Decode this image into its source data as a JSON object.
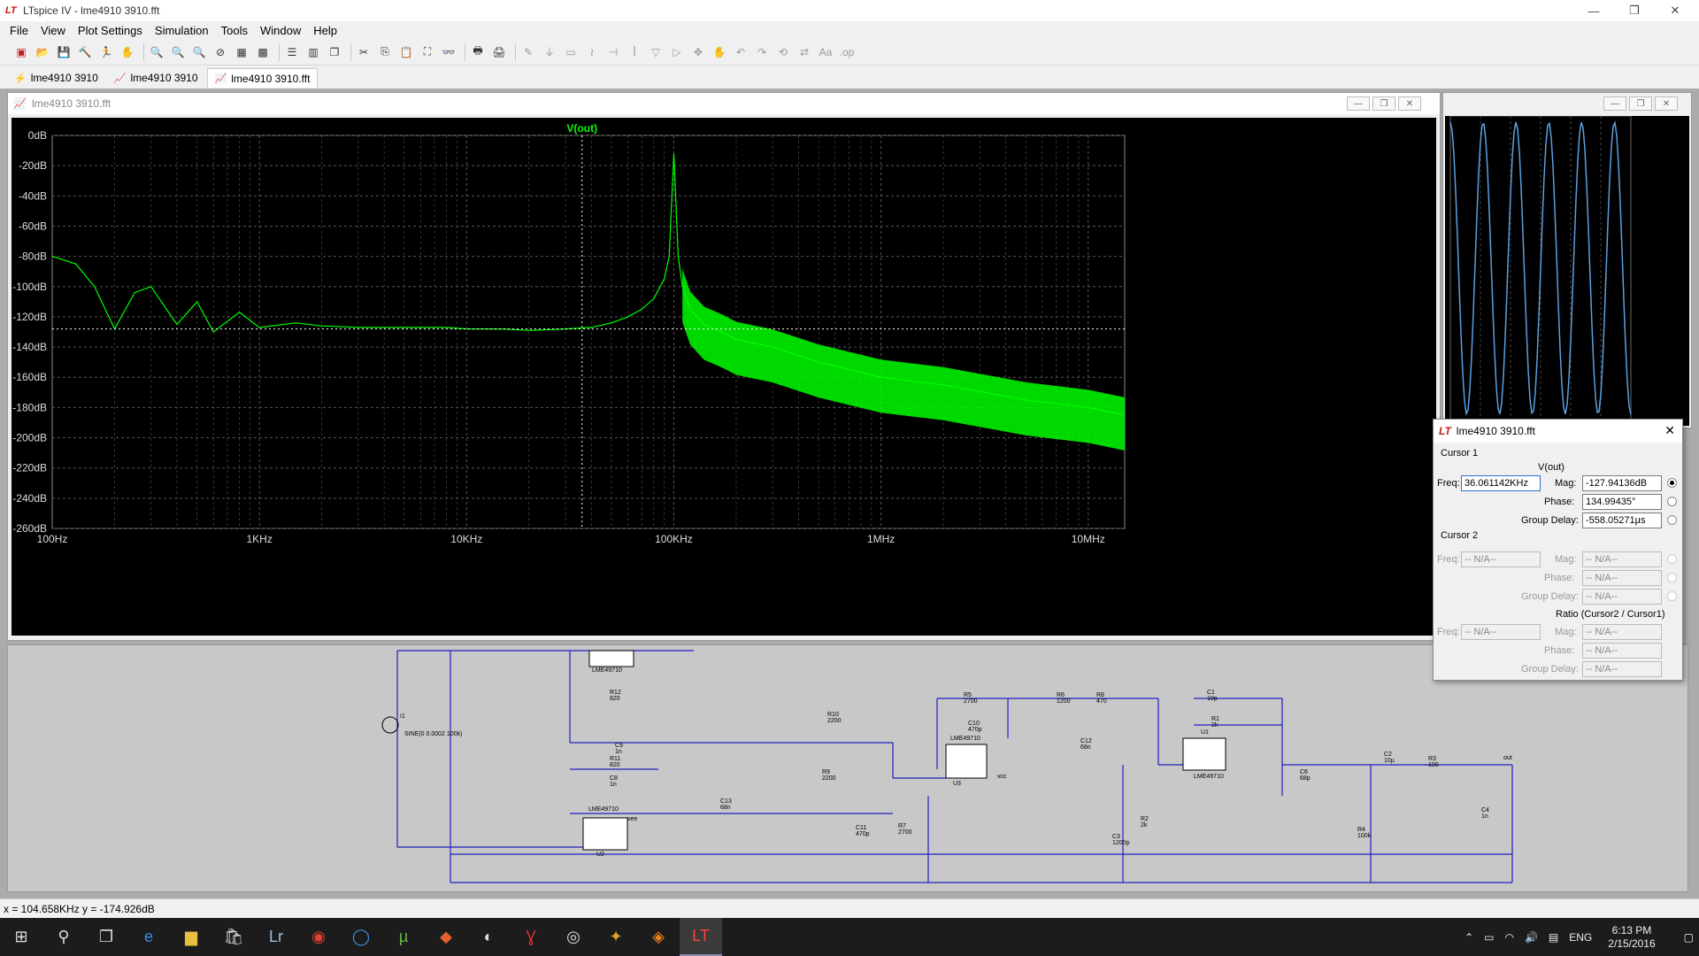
{
  "window": {
    "title": "LTspice IV - lme4910 3910.fft",
    "logo": "LT",
    "minimize": "—",
    "restore": "❐",
    "close": "✕"
  },
  "menu": [
    "File",
    "View",
    "Plot Settings",
    "Simulation",
    "Tools",
    "Window",
    "Help"
  ],
  "tabs": [
    {
      "label": "lme4910 3910",
      "icon": "schematic-icon"
    },
    {
      "label": "lme4910 3910",
      "icon": "waveform-icon"
    },
    {
      "label": "lme4910 3910.fft",
      "icon": "waveform-icon"
    }
  ],
  "plot_window": {
    "title": "lme4910 3910.fft"
  },
  "chart_data": {
    "type": "line",
    "title": "V(out)",
    "x_scale": "log",
    "xlim": [
      100,
      15000000
    ],
    "ylim": [
      -260,
      0
    ],
    "x_tick_labels": [
      "100Hz",
      "1KHz",
      "10KHz",
      "100KHz",
      "1MHz",
      "10MHz"
    ],
    "x_ticks": [
      100,
      1000,
      10000,
      100000,
      1000000,
      10000000
    ],
    "y_tick_labels": [
      "0dB",
      "-20dB",
      "-40dB",
      "-60dB",
      "-80dB",
      "-100dB",
      "-120dB",
      "-140dB",
      "-160dB",
      "-180dB",
      "-200dB",
      "-220dB",
      "-240dB",
      "-260dB"
    ],
    "y_ticks": [
      0,
      -20,
      -40,
      -60,
      -80,
      -100,
      -120,
      -140,
      -160,
      -180,
      -200,
      -220,
      -240,
      -260
    ],
    "grid": true,
    "series": [
      {
        "name": "V(out)",
        "color": "#00ff00",
        "x": [
          100,
          130,
          160,
          200,
          250,
          300,
          400,
          500,
          600,
          800,
          1000,
          1500,
          2000,
          3000,
          5000,
          8000,
          10000,
          15000,
          20000,
          30000,
          40000,
          50000,
          60000,
          70000,
          80000,
          90000,
          95000,
          100000,
          105000,
          110000,
          120000,
          140000,
          170000,
          200000,
          300000,
          500000,
          1000000,
          2000000,
          5000000,
          10000000,
          15000000
        ],
        "y": [
          -80,
          -85,
          -100,
          -128,
          -104,
          -100,
          -125,
          -110,
          -130,
          -117,
          -127,
          -124,
          -126,
          -127,
          -127,
          -127,
          -128,
          -128,
          -129,
          -128,
          -127,
          -124,
          -120,
          -115,
          -108,
          -95,
          -80,
          -12,
          -80,
          -100,
          -115,
          -125,
          -130,
          -135,
          -140,
          -150,
          -160,
          -165,
          -175,
          -180,
          -185
        ]
      }
    ],
    "cursor": {
      "x": 36061,
      "y": -128
    }
  },
  "cursor_dialog": {
    "title": "lme4910 3910.fft",
    "cursor1_label": "Cursor 1",
    "trace": "V(out)",
    "freq_label": "Freq:",
    "freq": "36.061142KHz",
    "mag_label": "Mag:",
    "mag": "-127.94136dB",
    "phase_label": "Phase:",
    "phase": "134.99435°",
    "gd_label": "Group Delay:",
    "gd": "-558.05271µs",
    "cursor2_label": "Cursor 2",
    "na": "-- N/A--",
    "ratio_label": "Ratio (Cursor2 / Cursor1)"
  },
  "status": {
    "readout": "x = 104.658KHz    y = -174.926dB"
  },
  "taskbar": {
    "lang": "ENG",
    "time": "6:13 PM",
    "date": "2/15/2016"
  },
  "schematic": {
    "labels": [
      "LME49710",
      "R12",
      "820",
      "C9",
      "1n",
      "R10",
      "2200",
      "R11",
      "820",
      "C8",
      "1n",
      "R9",
      "2200",
      "LME49710",
      "U2",
      "C13",
      "68n",
      "C11",
      "470p",
      "R7",
      "2700",
      "R5",
      "2700",
      "C10",
      "470p",
      "LME49710",
      "U3",
      "C12",
      "68n",
      "R6",
      "1200",
      "R8",
      "470",
      "C3",
      "1200p",
      "R2",
      "2k",
      "C1",
      "10p",
      "R1",
      "2k",
      "U1",
      "LME49710",
      "C6",
      "68p",
      "C2",
      "10µ",
      "R3",
      "100",
      "R4",
      "100k",
      "C4",
      "1n",
      "I1",
      "SINE(0 0.0002 100k)",
      "out",
      "vee",
      "vcc"
    ]
  }
}
